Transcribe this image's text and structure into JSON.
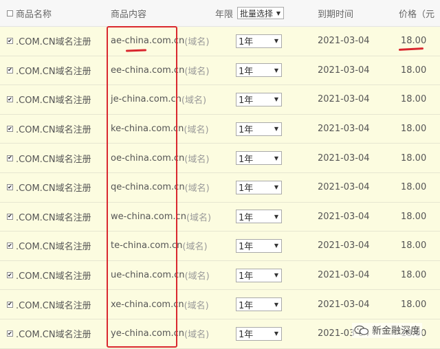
{
  "header": {
    "product_name": "商品名称",
    "content": "商品内容",
    "years_label": "年限",
    "batch_select": "批量选择",
    "expiry": "到期时间",
    "price": "价格（元"
  },
  "rows": [
    {
      "product": ".COM.CN域名注册",
      "domain": "ae-china.com.cn",
      "suffix": "(域名)",
      "years": "1年",
      "expiry": "2021-03-04",
      "price": "18.00"
    },
    {
      "product": ".COM.CN域名注册",
      "domain": "ee-china.com.cn",
      "suffix": "(域名)",
      "years": "1年",
      "expiry": "2021-03-04",
      "price": "18.00"
    },
    {
      "product": ".COM.CN域名注册",
      "domain": "je-china.com.cn",
      "suffix": "(域名)",
      "years": "1年",
      "expiry": "2021-03-04",
      "price": "18.00"
    },
    {
      "product": ".COM.CN域名注册",
      "domain": "ke-china.com.cn",
      "suffix": "(域名)",
      "years": "1年",
      "expiry": "2021-03-04",
      "price": "18.00"
    },
    {
      "product": ".COM.CN域名注册",
      "domain": "oe-china.com.cn",
      "suffix": "(域名)",
      "years": "1年",
      "expiry": "2021-03-04",
      "price": "18.00"
    },
    {
      "product": ".COM.CN域名注册",
      "domain": "qe-china.com.cn",
      "suffix": "(域名)",
      "years": "1年",
      "expiry": "2021-03-04",
      "price": "18.00"
    },
    {
      "product": ".COM.CN域名注册",
      "domain": "we-china.com.cn",
      "suffix": "(域名)",
      "years": "1年",
      "expiry": "2021-03-04",
      "price": "18.00"
    },
    {
      "product": ".COM.CN域名注册",
      "domain": "te-china.com.cn",
      "suffix": "(域名)",
      "years": "1年",
      "expiry": "2021-03-04",
      "price": "18.00"
    },
    {
      "product": ".COM.CN域名注册",
      "domain": "ue-china.com.cn",
      "suffix": "(域名)",
      "years": "1年",
      "expiry": "2021-03-04",
      "price": "18.00"
    },
    {
      "product": ".COM.CN域名注册",
      "domain": "xe-china.com.cn",
      "suffix": "(域名)",
      "years": "1年",
      "expiry": "2021-03-04",
      "price": "18.00"
    },
    {
      "product": ".COM.CN域名注册",
      "domain": "ye-china.com.cn",
      "suffix": "(域名)",
      "years": "1年",
      "expiry": "2021-03-04",
      "price": "18.00"
    }
  ],
  "watermark": {
    "text": "新金融深度",
    "icon": "wechat-icon"
  },
  "colors": {
    "row_bg": "#fcfce0",
    "annotation_red": "#d9272e"
  }
}
